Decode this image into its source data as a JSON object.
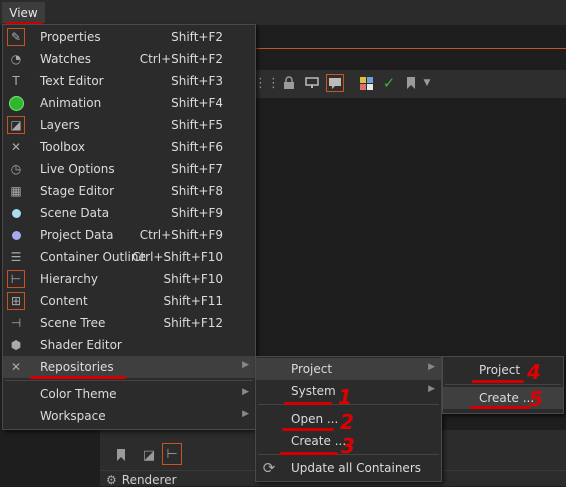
{
  "menubar": {
    "view_label": "View"
  },
  "view_menu": {
    "items": [
      {
        "label": "Properties",
        "shortcut": "Shift+F2",
        "icon": "pencil-icon"
      },
      {
        "label": "Watches",
        "shortcut": "Ctrl+Shift+F2",
        "icon": "watch-icon"
      },
      {
        "label": "Text Editor",
        "shortcut": "Shift+F3",
        "icon": "text-icon"
      },
      {
        "label": "Animation",
        "shortcut": "Shift+F4",
        "icon": "animation-icon"
      },
      {
        "label": "Layers",
        "shortcut": "Shift+F5",
        "icon": "layers-icon"
      },
      {
        "label": "Toolbox",
        "shortcut": "Shift+F6",
        "icon": "toolbox-icon"
      },
      {
        "label": "Live Options",
        "shortcut": "Shift+F7",
        "icon": "clock-icon"
      },
      {
        "label": "Stage Editor",
        "shortcut": "Shift+F8",
        "icon": "stage-icon"
      },
      {
        "label": "Scene Data",
        "shortcut": "Shift+F9",
        "icon": "scene-data-icon"
      },
      {
        "label": "Project Data",
        "shortcut": "Ctrl+Shift+F9",
        "icon": "project-data-icon"
      },
      {
        "label": "Container Outline",
        "shortcut": "Ctrl+Shift+F10",
        "icon": "outline-icon"
      },
      {
        "label": "Hierarchy",
        "shortcut": "Shift+F10",
        "icon": "hierarchy-icon"
      },
      {
        "label": "Content",
        "shortcut": "Shift+F11",
        "icon": "content-icon"
      },
      {
        "label": "Scene Tree",
        "shortcut": "Shift+F12",
        "icon": "scene-tree-icon"
      },
      {
        "label": "Shader Editor",
        "shortcut": "",
        "icon": "shader-icon"
      },
      {
        "label": "Repositories",
        "shortcut": "",
        "icon": "repositories-icon"
      }
    ],
    "color_theme": "Color Theme",
    "workspace": "Workspace"
  },
  "repositories_menu": {
    "project": "Project",
    "system": "System",
    "open": "Open ...",
    "create": "Create ...",
    "update_all": "Update all Containers"
  },
  "project_menu": {
    "project": "Project",
    "create": "Create ..."
  },
  "annotations": [
    "1",
    "2",
    "3",
    "4",
    "5"
  ],
  "bottom_panel": {
    "renderer_label": "Renderer"
  },
  "colors": {
    "accent": "#c8551f",
    "highlight": "#d40000",
    "green": "#2db82d"
  }
}
